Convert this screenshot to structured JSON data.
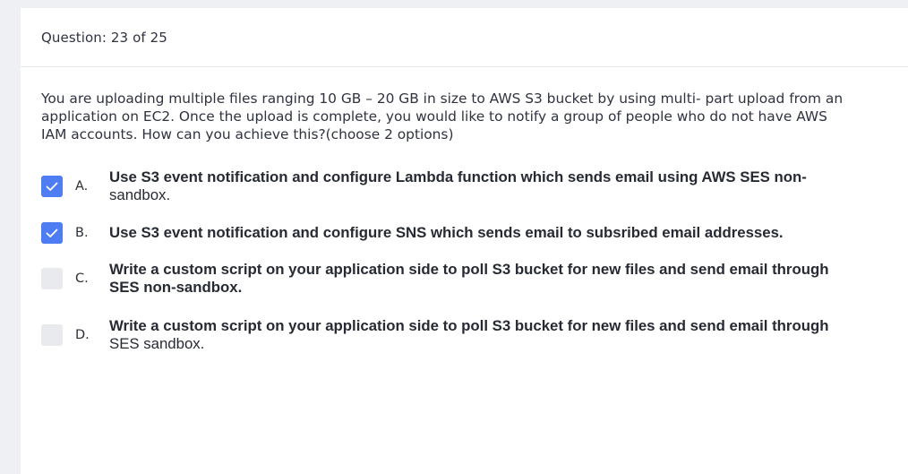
{
  "header": {
    "question_counter": "Question: 23 of 25"
  },
  "question": {
    "text": "You are uploading multiple files ranging 10 GB – 20 GB in size to AWS S3 bucket by using multi- part upload from an application on EC2. Once the upload is complete, you would like to notify a group of people who do not have AWS IAM accounts. How can you achieve this?(choose 2 options)"
  },
  "options": [
    {
      "letter": "A.",
      "text_main": "Use S3 event notification and configure Lambda function which sends email using AWS SES non-",
      "text_tail": "sandbox.",
      "checked": true
    },
    {
      "letter": "B.",
      "text_main": "Use S3 event notification and configure SNS which sends email to subsribed email addresses.",
      "text_tail": "",
      "checked": true
    },
    {
      "letter": "C.",
      "text_main": "Write a custom script on your application side to poll S3 bucket for new files and send email through",
      "text_tail": "SES non-sandbox.",
      "checked": false
    },
    {
      "letter": "D.",
      "text_main": "Write a custom script on your application side to poll S3 bucket for new files and send email through",
      "text_tail": "SES sandbox.",
      "checked": false
    }
  ],
  "colors": {
    "checkbox_checked": "#4e7cf3",
    "checkbox_unchecked": "#e9eaee"
  }
}
